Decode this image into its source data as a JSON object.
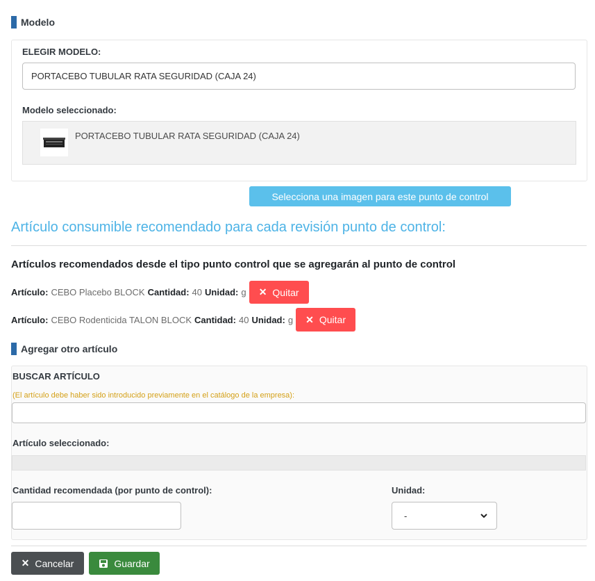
{
  "model_section": {
    "title": "Modelo",
    "choose_label": "ELEGIR MODELO:",
    "choose_value": "PORTACEBO TUBULAR RATA SEGURIDAD (CAJA 24)",
    "selected_label": "Modelo seleccionado:",
    "selected_name": "PORTACEBO TUBULAR RATA SEGURIDAD (CAJA 24)",
    "image_button": "Selecciona una imagen para este punto de control"
  },
  "consumables": {
    "heading": "Artículo consumible recomendado para cada revisión punto de control:",
    "subheading": "Artículos recomendados desde el tipo punto control que se agregarán al punto de control",
    "items": [
      {
        "article_label": "Artículo:",
        "article": "CEBO Placebo BLOCK",
        "qty_label": "Cantidad:",
        "qty": "40",
        "unit_label": "Unidad:",
        "unit": "g",
        "remove": "Quitar"
      },
      {
        "article_label": "Artículo:",
        "article": "CEBO Rodenticida TALON BLOCK",
        "qty_label": "Cantidad:",
        "qty": "40",
        "unit_label": "Unidad:",
        "unit": "g",
        "remove": "Quitar"
      }
    ]
  },
  "add_article": {
    "title": "Agregar otro artículo",
    "search_label": "BUSCAR ARTÍCULO",
    "search_hint": "(El artículo debe haber sido introducido previamente en el catálogo de la empresa):",
    "search_value": "",
    "selected_label": "Artículo seleccionado:",
    "qty_label": "Cantidad recomendada (por punto de control):",
    "qty_value": "",
    "unit_label": "Unidad:",
    "unit_value": "-"
  },
  "actions": {
    "cancel": "Cancelar",
    "save": "Guardar"
  },
  "colors": {
    "accent_bar": "#2c6aa8",
    "heading_blue": "#4db3e6",
    "danger": "#ff4d4f",
    "success": "#3a8a3d",
    "hint": "#d4a017"
  }
}
